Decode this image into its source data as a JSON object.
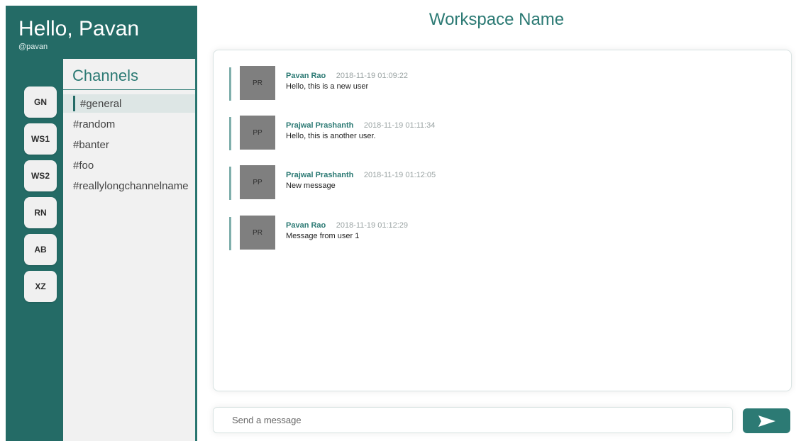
{
  "user": {
    "greeting": "Hello, Pavan",
    "handle": "@pavan"
  },
  "workspaces": [
    "GN",
    "WS1",
    "WS2",
    "RN",
    "AB",
    "XZ"
  ],
  "channels": {
    "title": "Channels",
    "items": [
      "#general",
      "#random",
      "#banter",
      "#foo",
      "#reallylongchannelname"
    ],
    "active": "#general"
  },
  "workspace_title": "Workspace Name",
  "messages": [
    {
      "initials": "PR",
      "name": "Pavan Rao",
      "time": "2018-11-19 01:09:22",
      "text": "Hello, this is a new user"
    },
    {
      "initials": "PP",
      "name": "Prajwal Prashanth",
      "time": "2018-11-19 01:11:34",
      "text": "Hello, this is another user."
    },
    {
      "initials": "PP",
      "name": "Prajwal Prashanth",
      "time": "2018-11-19 01:12:05",
      "text": "New message"
    },
    {
      "initials": "PR",
      "name": "Pavan Rao",
      "time": "2018-11-19 01:12:29",
      "text": "Message from user 1"
    }
  ],
  "composer": {
    "placeholder": "Send a message"
  },
  "send": {
    "icon": "send-arrow-icon"
  },
  "colors": {
    "primary": "#246b66",
    "accent": "#2c7a74"
  }
}
